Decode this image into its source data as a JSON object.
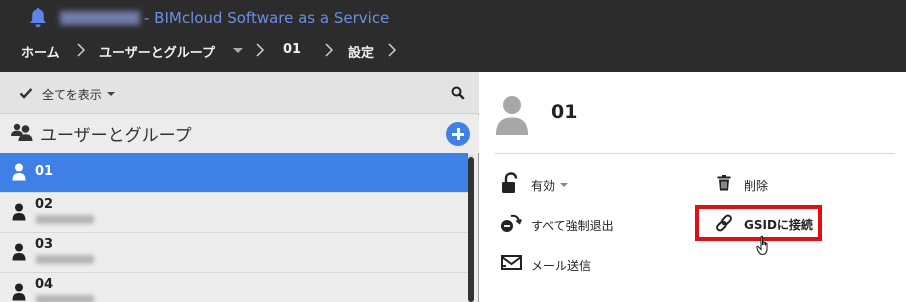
{
  "window": {
    "app_title": "- BIMcloud Software as a Service"
  },
  "breadcrumb": {
    "home": "ホーム",
    "users_groups": "ユーザーとグループ",
    "current": "01",
    "settings": "設定"
  },
  "left": {
    "filter_label": "全てを表示",
    "group_title": "ユーザーとグループ",
    "items": [
      {
        "name": "01"
      },
      {
        "name": "02"
      },
      {
        "name": "03"
      },
      {
        "name": "04"
      }
    ]
  },
  "right": {
    "title": "01",
    "actions": {
      "status": "有効",
      "delete": "削除",
      "force_logout": "すべて強制退出",
      "connect_gsid": "GSIDに接続",
      "send_mail": "メール送信"
    }
  },
  "colors": {
    "topbar": "#2c2c2c",
    "title_link": "#6b8fe6",
    "selected": "#3f80e6",
    "highlight": "#e01010"
  }
}
